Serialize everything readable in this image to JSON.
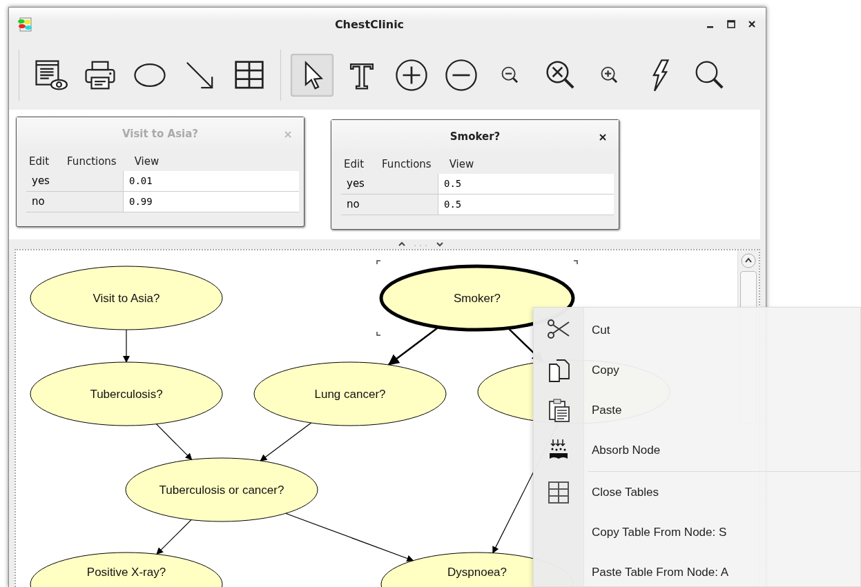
{
  "window": {
    "title": "ChestClinic"
  },
  "toolbar": {
    "tools": [
      {
        "kind": "preview",
        "selected": false
      },
      {
        "kind": "print",
        "selected": false
      },
      {
        "kind": "ellipse",
        "selected": false
      },
      {
        "kind": "arrow",
        "selected": false
      },
      {
        "kind": "table",
        "selected": false
      },
      {
        "kind": "pointer",
        "selected": true
      },
      {
        "kind": "text",
        "selected": false
      },
      {
        "kind": "plus",
        "selected": false
      },
      {
        "kind": "minus",
        "selected": false
      },
      {
        "kind": "zoomout",
        "selected": false
      },
      {
        "kind": "zoomfit",
        "selected": false
      },
      {
        "kind": "zoomin",
        "selected": false
      },
      {
        "kind": "lightning",
        "selected": false
      },
      {
        "kind": "search",
        "selected": false
      }
    ]
  },
  "tables": [
    {
      "title": "Visit to Asia?",
      "active": false,
      "menu": [
        "Edit",
        "Functions",
        "View"
      ],
      "rows": [
        {
          "state": "yes",
          "value": "0.01"
        },
        {
          "state": "no",
          "value": "0.99"
        }
      ]
    },
    {
      "title": "Smoker?",
      "active": true,
      "menu": [
        "Edit",
        "Functions",
        "View"
      ],
      "rows": [
        {
          "state": "yes",
          "value": "0.5"
        },
        {
          "state": "no",
          "value": "0.5"
        }
      ]
    }
  ],
  "network": {
    "nodes": [
      {
        "label": "Visit to Asia?",
        "selected": false
      },
      {
        "label": "Smoker?",
        "selected": true
      },
      {
        "label": "Tuberculosis?",
        "selected": false
      },
      {
        "label": "Lung cancer?",
        "selected": false
      },
      {
        "selected": false
      },
      {
        "label": "Tuberculosis or cancer?",
        "selected": false
      },
      {
        "label": "Positive X-ray?",
        "selected": false
      },
      {
        "label": "Dyspnoea?",
        "selected": false
      }
    ]
  },
  "context_menu": {
    "items": [
      {
        "label": "Cut",
        "kind": "cut",
        "separator_before": false
      },
      {
        "label": "Copy",
        "kind": "copy",
        "separator_before": false
      },
      {
        "label": "Paste",
        "kind": "paste",
        "separator_before": false
      },
      {
        "label": "Absorb Node",
        "kind": "absorb",
        "separator_before": false
      },
      {
        "label": "Close Tables",
        "kind": "table",
        "separator_before": true
      },
      {
        "label": "Copy Table From Node: S",
        "kind": "plain",
        "separator_before": false
      },
      {
        "label": "Paste Table From Node: A",
        "kind": "plain",
        "separator_before": false
      }
    ]
  }
}
